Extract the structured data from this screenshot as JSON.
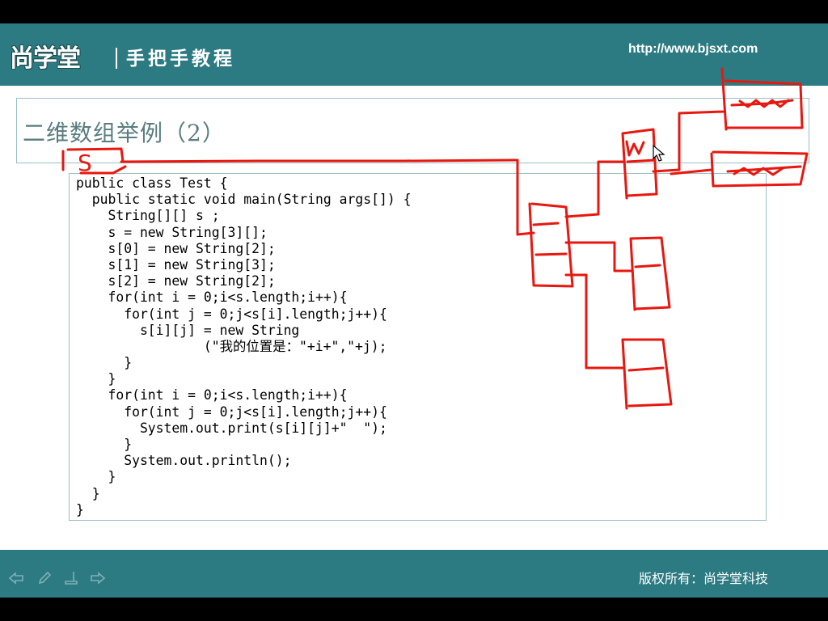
{
  "header": {
    "logo_text": "尚学堂",
    "tagline": "手把手教程",
    "site_url": "http://www.bjsxt.com"
  },
  "slide": {
    "title": "二维数组举例（2）",
    "code_lines": [
      "public class Test {",
      "  public static void main(String args[]) {",
      "    String[][] s ;",
      "    s = new String[3][];",
      "    s[0] = new String[2];",
      "    s[1] = new String[3];",
      "    s[2] = new String[2];",
      "    for(int i = 0;i<s.length;i++){",
      "      for(int j = 0;j<s[i].length;j++){",
      "        s[i][j] = new String",
      "                (\"我的位置是：\"+i+\",\"+j);",
      "      }",
      "    }",
      "    for(int i = 0;i<s.length;i++){",
      "      for(int j = 0;j<s[i].length;j++){",
      "        System.out.print(s[i][j]+\"  \");",
      "      }",
      "      System.out.println();",
      "    }",
      "  }",
      "}"
    ]
  },
  "annotation": {
    "handwritten_label": "S",
    "ink_color": "#e8170f"
  },
  "footer": {
    "copyright": "版权所有：尚学堂科技",
    "nav_icons": [
      "prev-arrow-icon",
      "pen-icon",
      "screen-icon",
      "next-arrow-icon"
    ]
  },
  "colors": {
    "brand_teal": "#2c7b82",
    "title_text": "#5a7d80",
    "box_border": "#9bbfc3"
  }
}
